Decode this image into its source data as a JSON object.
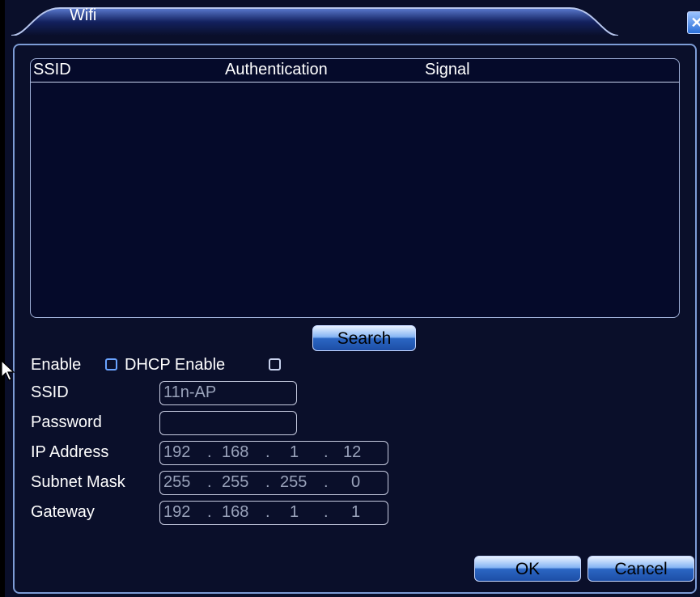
{
  "window": {
    "title": "Wifi",
    "close_label": "✕",
    "colors": {
      "background": "#0a0f2a",
      "border": "#7d9cd6",
      "text": "#ffffff"
    }
  },
  "network_list": {
    "columns": [
      "SSID",
      "Authentication",
      "Signal"
    ],
    "rows": []
  },
  "search_button": "Search",
  "options": {
    "enable_label": "Enable",
    "enable_checked": false,
    "dhcp_label": "DHCP Enable",
    "dhcp_checked": false
  },
  "form": {
    "ssid_label": "SSID",
    "ssid_value": "11n-AP",
    "password_label": "Password",
    "password_value": "",
    "ip_label": "IP Address",
    "ip_value": [
      "192",
      "168",
      "1",
      "12"
    ],
    "mask_label": "Subnet Mask",
    "mask_value": [
      "255",
      "255",
      "255",
      "0"
    ],
    "gateway_label": "Gateway",
    "gateway_value": [
      "192",
      "168",
      "1",
      "1"
    ]
  },
  "buttons": {
    "ok": "OK",
    "cancel": "Cancel"
  }
}
